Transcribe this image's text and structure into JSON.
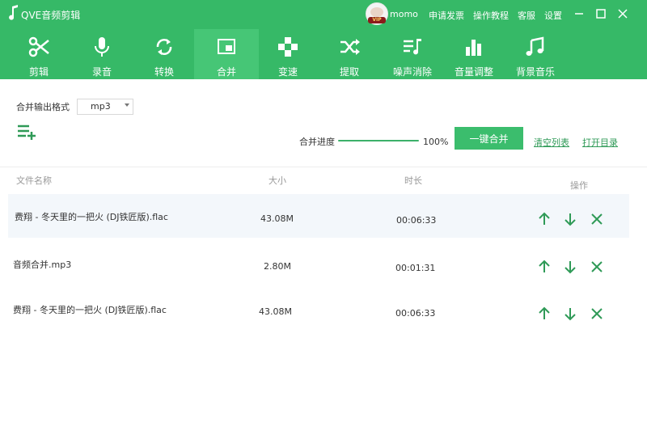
{
  "titlebar": {
    "app_title": "QVE音频剪辑",
    "username": "momo",
    "vip_badge": "VIP",
    "links": [
      "申请发票",
      "操作教程",
      "客服",
      "设置"
    ]
  },
  "toolbar": {
    "tools": [
      "剪辑",
      "录音",
      "转换",
      "合并",
      "变速",
      "提取",
      "噪声消除",
      "音量调整",
      "背景音乐"
    ],
    "active": "合并"
  },
  "merge": {
    "output_format_label": "合并输出格式",
    "output_format_value": "mp3",
    "progress_label": "合并进度",
    "progress_value": "100%",
    "progress_fraction": 1.0,
    "merge_button": "一键合并",
    "clear_list": "清空列表",
    "open_dir": "打开目录"
  },
  "table": {
    "headers": [
      "文件名称",
      "大小",
      "时长",
      "操作"
    ],
    "rows": [
      {
        "name": "费翔 - 冬天里的一把火 (DJ铁匠版).flac",
        "size": "43.08M",
        "duration": "00:06:33"
      },
      {
        "name": "音频合并.mp3",
        "size": "2.80M",
        "duration": "00:01:31"
      },
      {
        "name": "费翔 - 冬天里的一把火 (DJ铁匠版).flac",
        "size": "43.08M",
        "duration": "00:06:33"
      }
    ]
  },
  "colors": {
    "brand_green": "#36b967",
    "active_tab": "#46c676",
    "icon_green": "#2f9a57"
  }
}
